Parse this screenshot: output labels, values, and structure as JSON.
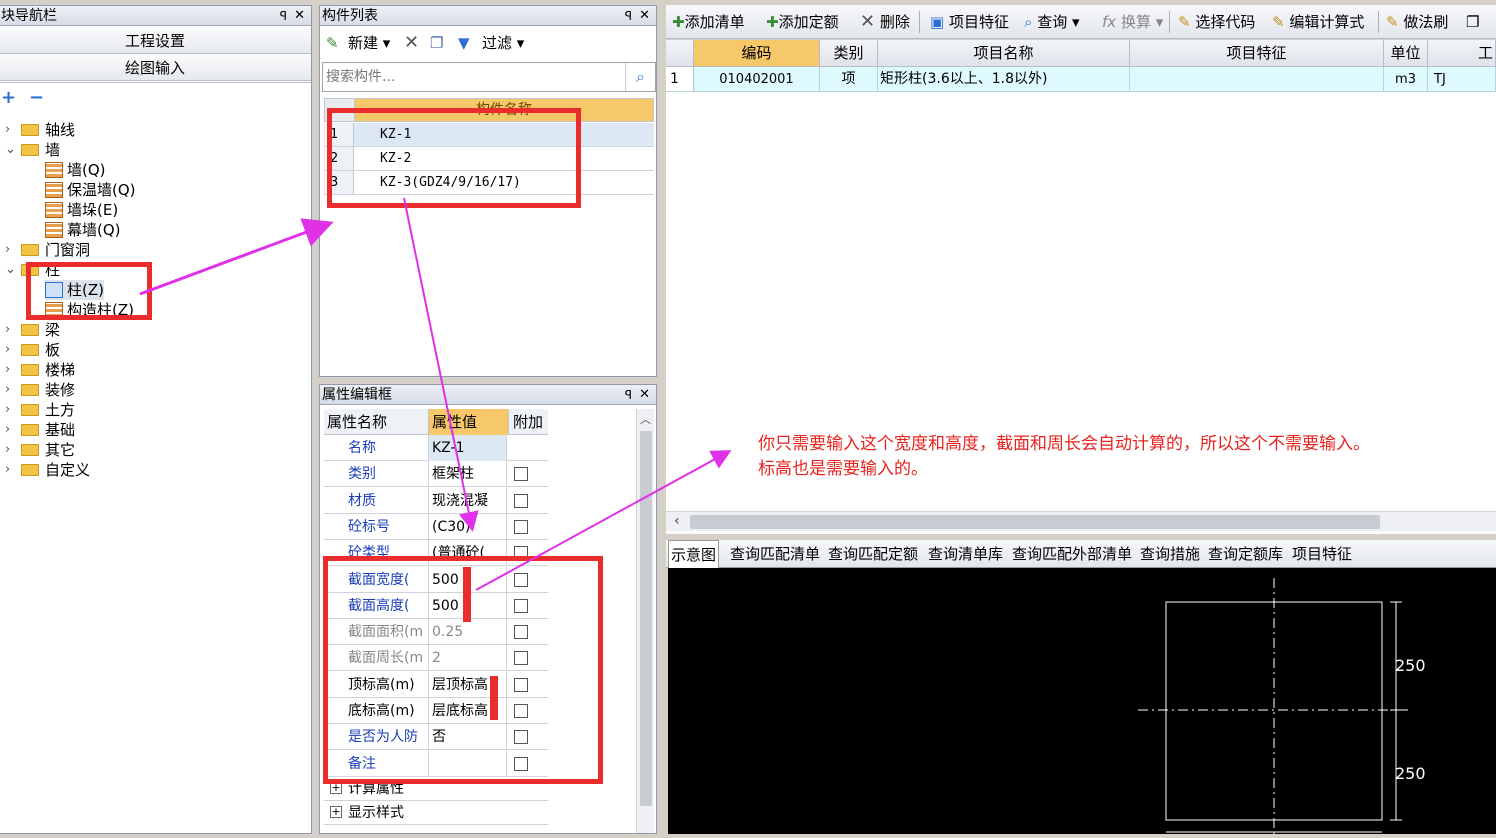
{
  "nav": {
    "title": "模块导航栏",
    "title_visible": "块导航栏",
    "buttons": [
      "工程设置",
      "绘图输入"
    ],
    "plus": "+",
    "minus": "−",
    "tree": [
      {
        "label": "轴线",
        "level": 0,
        "expanded": false
      },
      {
        "label": "墙",
        "level": 0,
        "expanded": true
      },
      {
        "label": "墙(Q)",
        "level": 1
      },
      {
        "label": "保温墙(Q)",
        "level": 1
      },
      {
        "label": "墙垛(E)",
        "level": 1
      },
      {
        "label": "幕墙(Q)",
        "level": 1
      },
      {
        "label": "门窗洞",
        "level": 0,
        "expanded": false
      },
      {
        "label": "柱",
        "level": 0,
        "expanded": true
      },
      {
        "label": "柱(Z)",
        "level": 1,
        "selected": true
      },
      {
        "label": "构造柱(Z)",
        "level": 1
      },
      {
        "label": "梁",
        "level": 0,
        "expanded": false
      },
      {
        "label": "板",
        "level": 0,
        "expanded": false
      },
      {
        "label": "楼梯",
        "level": 0,
        "expanded": false
      },
      {
        "label": "装修",
        "level": 0,
        "expanded": false
      },
      {
        "label": "土方",
        "level": 0,
        "expanded": false
      },
      {
        "label": "基础",
        "level": 0,
        "expanded": false
      },
      {
        "label": "其它",
        "level": 0,
        "expanded": false
      },
      {
        "label": "自定义",
        "level": 0,
        "expanded": false
      }
    ]
  },
  "component_list": {
    "title": "构件列表",
    "toolbar": {
      "new": "新建",
      "filter": "过滤"
    },
    "search_placeholder": "搜索构件...",
    "header": "构件名称",
    "rows": [
      {
        "num": "1",
        "name": "KZ-1"
      },
      {
        "num": "2",
        "name": "KZ-2"
      },
      {
        "num": "3",
        "name": "KZ-3(GDZ4/9/16/17)"
      }
    ]
  },
  "property_editor": {
    "title": "属性编辑框",
    "headers": [
      "属性名称",
      "属性值",
      "附加"
    ],
    "rows": [
      {
        "name": "名称",
        "value": "KZ-1",
        "style": "blue"
      },
      {
        "name": "类别",
        "value": "框架柱",
        "style": "blue"
      },
      {
        "name": "材质",
        "value": "现浇混凝",
        "style": "blue"
      },
      {
        "name": "砼标号",
        "value": "(C30)",
        "style": "blue"
      },
      {
        "name": "砼类型",
        "value": "(普通砼(",
        "style": "blue"
      },
      {
        "name": "截面宽度(",
        "value": "500",
        "style": "blue"
      },
      {
        "name": "截面高度(",
        "value": "500",
        "style": "blue"
      },
      {
        "name": "截面面积(m",
        "value": "0.25",
        "style": "gray"
      },
      {
        "name": "截面周长(m",
        "value": "2",
        "style": "gray"
      },
      {
        "name": "顶标高(m)",
        "value": "层顶标高",
        "style": "black"
      },
      {
        "name": "底标高(m)",
        "value": "层底标高",
        "style": "black"
      },
      {
        "name": "是否为人防",
        "value": "否",
        "style": "blue"
      },
      {
        "name": "备注",
        "value": "",
        "style": "blue"
      }
    ],
    "groups": [
      "计算属性",
      "显示样式"
    ]
  },
  "toolbar": {
    "items": [
      "添加清单",
      "添加定额",
      "删除",
      "项目特征",
      "查询",
      "换算",
      "选择代码",
      "编辑计算式",
      "做法刷"
    ]
  },
  "quantity_table": {
    "headers": [
      "编码",
      "类别",
      "项目名称",
      "项目特征",
      "单位",
      "工"
    ],
    "row": {
      "num": "1",
      "code": "010402001",
      "type": "项",
      "name": "矩形柱(3.6以上、1.8以外)",
      "feature": "",
      "unit": "m3",
      "expr": "TJ"
    }
  },
  "bottom_tabs": [
    "示意图",
    "查询匹配清单",
    "查询匹配定额",
    "查询清单库",
    "查询匹配外部清单",
    "查询措施",
    "查询定额库",
    "项目特征"
  ],
  "preview": {
    "dim_top": "250",
    "dim_bottom": "250"
  },
  "annotation": {
    "line1": "你只需要输入这个宽度和高度，截面和周长会自动计算的，所以这个不需要输入。",
    "line2": "标高也是需要输入的。"
  },
  "colors": {
    "annotation": "#e8231e",
    "arrow": "#e030e8",
    "highlight_box": "#ea2c2c",
    "selected_row": "#dffaff",
    "header_orange": "#f7c86a"
  }
}
